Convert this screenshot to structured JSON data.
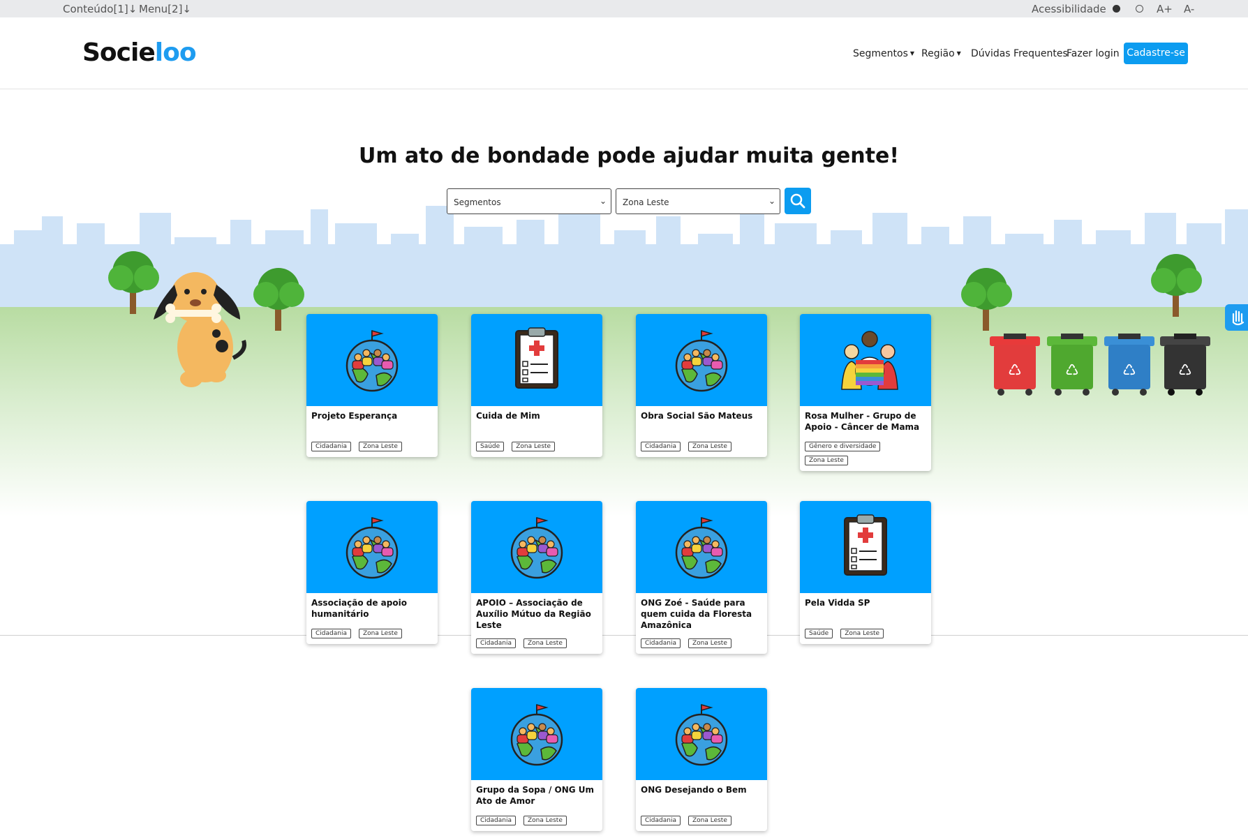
{
  "accessibility_bar": {
    "skip_content": "Conteúdo[1]↓",
    "skip_menu": "Menu[2]↓",
    "label": "Acessibilidade",
    "increase_font": "A+",
    "decrease_font": "A-"
  },
  "header": {
    "logo_part1": "Socie",
    "logo_part2": "loo",
    "nav": {
      "segments": "Segmentos",
      "region": "Região",
      "faq": "Dúvidas Frequentes",
      "login": "Fazer login",
      "signup": "Cadastre-se"
    }
  },
  "hero": {
    "title": "Um ato de bondade pode ajudar muita gente!",
    "segment_select": "Segmentos",
    "region_select": "Zona Leste"
  },
  "colors": {
    "accent": "#0c9cf0",
    "card_image_bg": "#00a0ff"
  },
  "cards": [
    {
      "title": "Projeto Esperança",
      "tags": [
        "Cidadania",
        "Zona Leste"
      ],
      "icon": "globe-people-icon"
    },
    {
      "title": "Cuida de Mim",
      "tags": [
        "Saúde",
        "Zona Leste"
      ],
      "icon": "clipboard-health-icon"
    },
    {
      "title": "Obra Social São Mateus",
      "tags": [
        "Cidadania",
        "Zona Leste"
      ],
      "icon": "globe-people-icon"
    },
    {
      "title": "Rosa Mulher - Grupo de Apoio - Câncer de Mama",
      "tags": [
        "Gênero e diversidade",
        "Zona Leste"
      ],
      "icon": "diverse-people-icon"
    },
    {
      "title": "Associação de apoio humanitário",
      "tags": [
        "Cidadania",
        "Zona Leste"
      ],
      "icon": "globe-people-icon"
    },
    {
      "title": "APOIO – Associação de Auxílio Mútuo da Região Leste",
      "tags": [
        "Cidadania",
        "Zona Leste"
      ],
      "icon": "globe-people-icon"
    },
    {
      "title": "ONG Zoé - Saúde para quem cuida da Floresta Amazônica",
      "tags": [
        "Cidadania",
        "Zona Leste"
      ],
      "icon": "globe-people-icon"
    },
    {
      "title": "Pela Vidda SP",
      "tags": [
        "Saúde",
        "Zona Leste"
      ],
      "icon": "clipboard-health-icon"
    },
    {
      "title": "Grupo da Sopa / ONG Um Ato de Amor",
      "tags": [
        "Cidadania",
        "Zona Leste"
      ],
      "icon": "globe-people-icon"
    },
    {
      "title": "ONG Desejando o Bem",
      "tags": [
        "Cidadania",
        "Zona Leste"
      ],
      "icon": "globe-people-icon"
    }
  ]
}
